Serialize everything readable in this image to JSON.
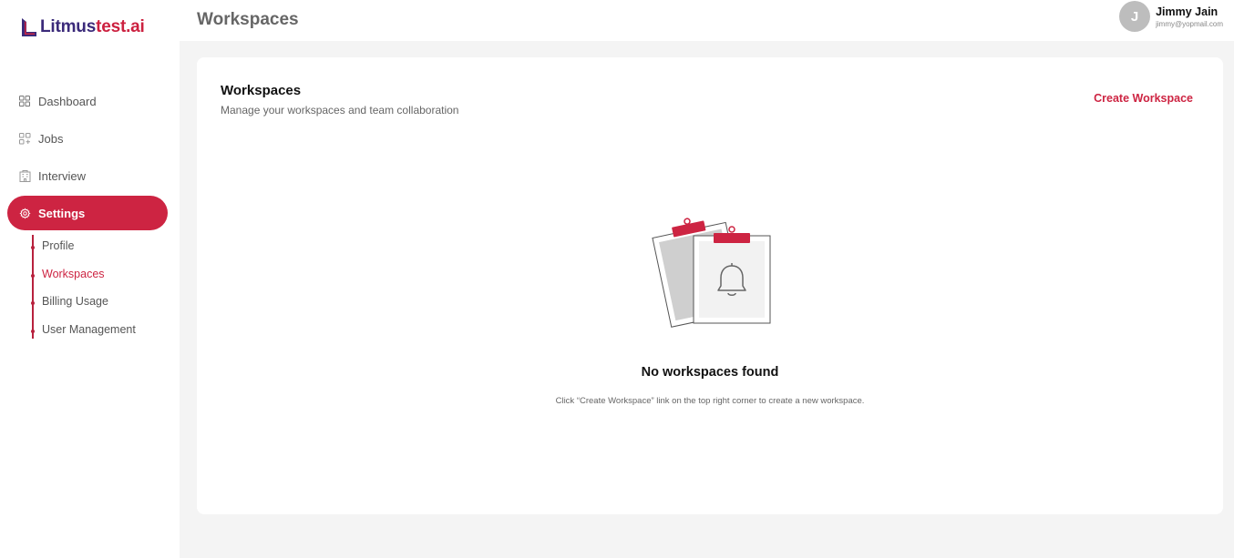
{
  "brand": {
    "name_part1": "Litmus",
    "name_part2": "test.ai",
    "primary_color": "#cd2442",
    "secondary_color": "#3b2a7a"
  },
  "header": {
    "title": "Workspaces"
  },
  "user": {
    "initial": "J",
    "name": "Jimmy Jain",
    "email": "jimmy@yopmail.com"
  },
  "sidebar": {
    "items": [
      {
        "label": "Dashboard",
        "icon": "grid-icon"
      },
      {
        "label": "Jobs",
        "icon": "grid-plus-icon"
      },
      {
        "label": "Interview",
        "icon": "building-icon"
      },
      {
        "label": "Settings",
        "icon": "gear-icon",
        "active": true
      }
    ],
    "settings_subitems": [
      {
        "label": "Profile"
      },
      {
        "label": "Workspaces",
        "active": true
      },
      {
        "label": "Billing Usage"
      },
      {
        "label": "User Management"
      }
    ]
  },
  "main": {
    "card_title": "Workspaces",
    "card_subtitle": "Manage your workspaces and team collaboration",
    "create_label": "Create Workspace",
    "empty_title": "No workspaces found",
    "empty_desc": "Click “Create Workspace” link on the top right corner to create a new workspace.",
    "empty_icon": "clipboard-bell-icon"
  }
}
